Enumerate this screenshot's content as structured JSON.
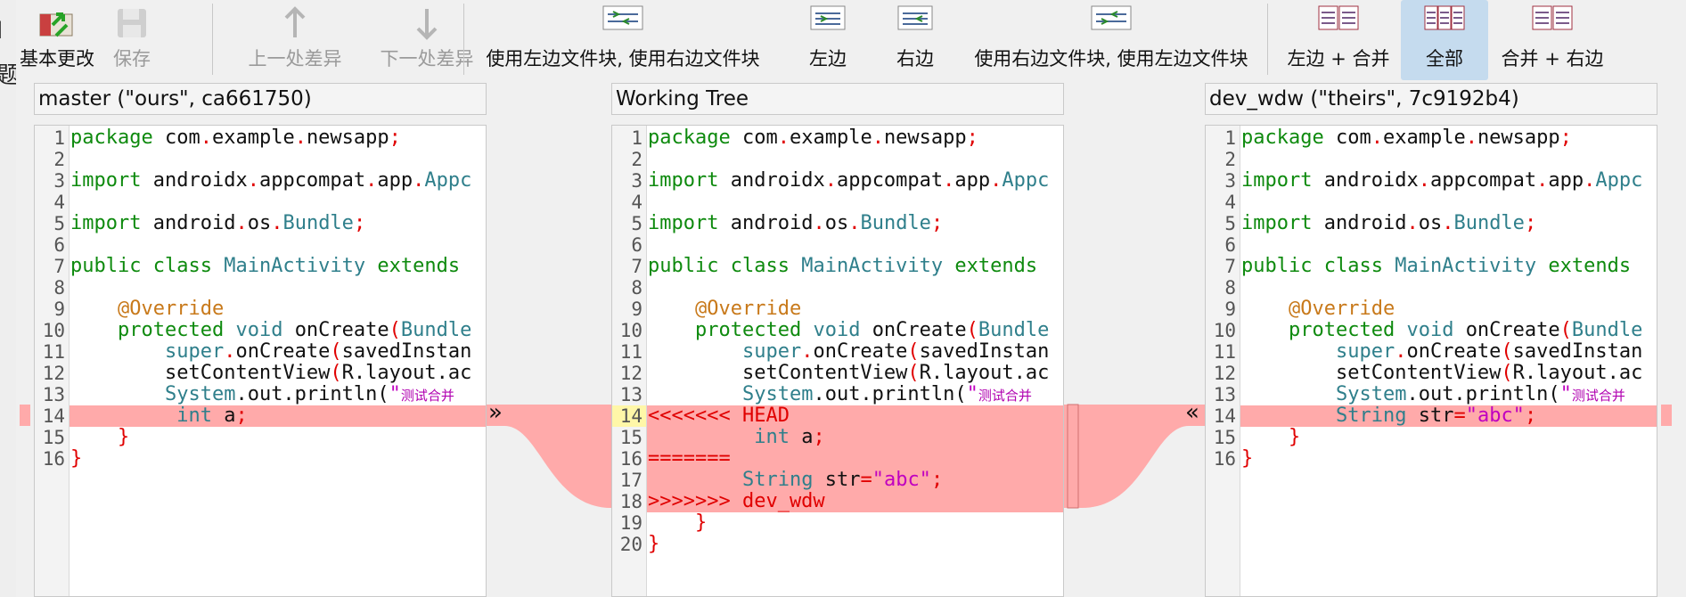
{
  "toolbar": {
    "basic_changes": "基本更改",
    "save": "保存",
    "prev_diff": "上一处差异",
    "next_diff": "下一处差异",
    "use_left_then_right": "使用左边文件块, 使用右边文件块",
    "left": "左边",
    "right": "右边",
    "use_right_then_left": "使用右边文件块, 使用左边文件块",
    "left_plus_merge": "左边 + 合并",
    "all": "全部",
    "merge_plus_right": "合并 + 右边"
  },
  "panes": {
    "left_title": "master (\"ours\", ca661750)",
    "middle_title": "Working Tree",
    "right_title": "dev_wdw (\"theirs\", 7c9192b4)"
  },
  "conflict_markers": {
    "head": "<<<<<<< HEAD",
    "separator": "=======",
    "tail": ">>>>>>> dev_wdw"
  },
  "code": {
    "package_kw": "package",
    "pkg_com": "com",
    "pkg_example": "example",
    "pkg_newsapp": "newsapp",
    "import_kw": "import",
    "androidx": "androidx",
    "appcompat": "appcompat",
    "app": "app",
    "appc_trunc": "Appc",
    "android": "android",
    "os": "os",
    "bundle": "Bundle",
    "public_class": "public class",
    "main_activity": "MainActivity",
    "extends": "extends",
    "override": "@Override",
    "protected": "protected",
    "void": "void",
    "on_create": "onCreate",
    "bundle_trunc": "Bundle",
    "super": "super",
    "saved_instance_trunc": "savedInstan",
    "set_content_view": "setContentView",
    "r_layout": "R.layout.ac",
    "system": "System",
    "out_println": ".out.println(",
    "string_open": "\"",
    "chinese_text": "测试合并",
    "int_kw": "int",
    "var_a": "a",
    "string_type": "String",
    "str_var": "str",
    "abc_lit": "\"abc\""
  },
  "left_code_lines": [
    "1",
    "2",
    "3",
    "4",
    "5",
    "6",
    "7",
    "8",
    "9",
    "10",
    "11",
    "12",
    "13",
    "14",
    "15",
    "16"
  ],
  "middle_code_lines": [
    "1",
    "2",
    "3",
    "4",
    "5",
    "6",
    "7",
    "8",
    "9",
    "10",
    "11",
    "12",
    "13",
    "14",
    "15",
    "16",
    "17",
    "18",
    "19",
    "20"
  ],
  "arrows": {
    "left": "»",
    "right": "«"
  },
  "colors": {
    "conflict_bg": "#ffaaaa",
    "active_button_bg": "#c5dbee"
  }
}
